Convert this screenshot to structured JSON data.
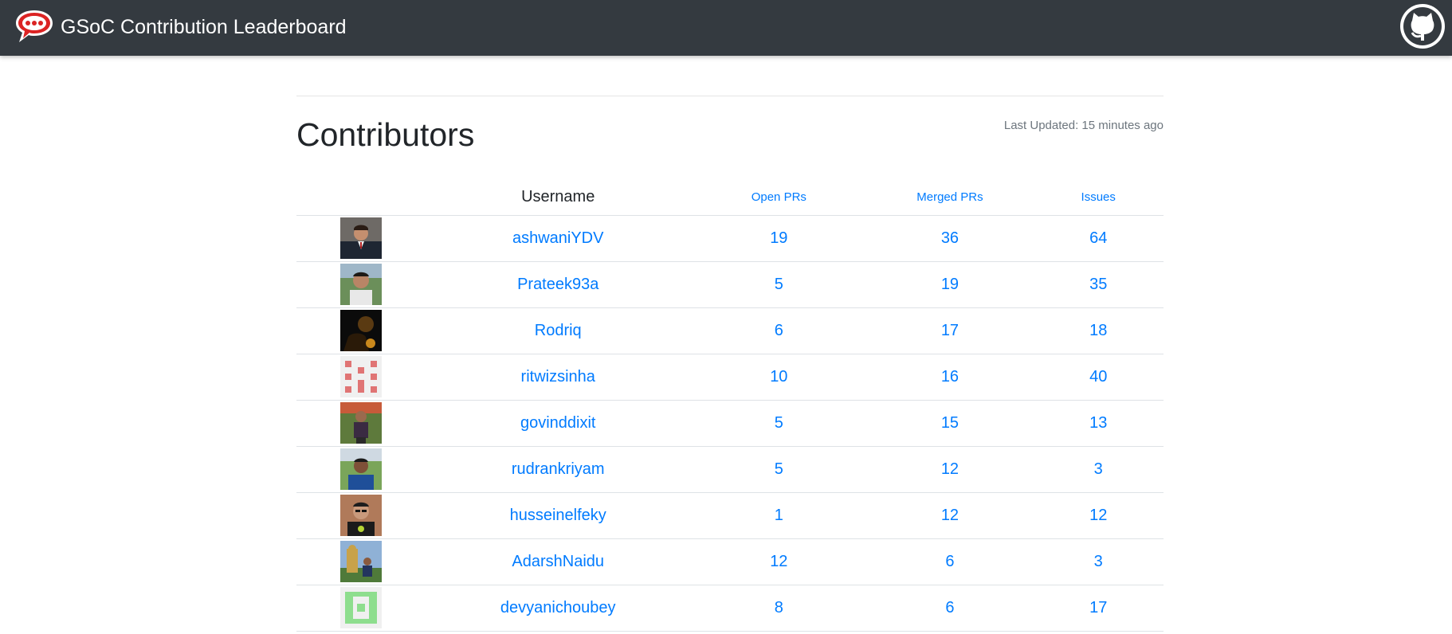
{
  "header": {
    "title": "GSoC Contribution Leaderboard",
    "logo_icon": "rocket-chat-logo-icon",
    "github_icon": "github-octocat-icon"
  },
  "page": {
    "heading": "Contributors",
    "last_updated": "Last Updated: 15 minutes ago"
  },
  "table": {
    "columns": [
      "",
      "Username",
      "Open PRs",
      "Merged PRs",
      "Issues"
    ],
    "rows": [
      {
        "avatar": "photo-man-suit",
        "username": "ashwaniYDV",
        "open_prs": "19",
        "merged_prs": "36",
        "issues": "64"
      },
      {
        "avatar": "photo-man-outdoor",
        "username": "Prateek93a",
        "open_prs": "5",
        "merged_prs": "19",
        "issues": "35"
      },
      {
        "avatar": "photo-silhouette",
        "username": "Rodriq",
        "open_prs": "6",
        "merged_prs": "17",
        "issues": "18"
      },
      {
        "avatar": "identicon-red",
        "username": "ritwizsinha",
        "open_prs": "10",
        "merged_prs": "16",
        "issues": "40"
      },
      {
        "avatar": "photo-man-garden",
        "username": "govinddixit",
        "open_prs": "5",
        "merged_prs": "15",
        "issues": "13"
      },
      {
        "avatar": "photo-man-blue-shirt",
        "username": "rudrankriyam",
        "open_prs": "5",
        "merged_prs": "12",
        "issues": "3"
      },
      {
        "avatar": "photo-man-glasses",
        "username": "husseinelfeky",
        "open_prs": "1",
        "merged_prs": "12",
        "issues": "12"
      },
      {
        "avatar": "photo-man-landmark",
        "username": "AdarshNaidu",
        "open_prs": "12",
        "merged_prs": "6",
        "issues": "3"
      },
      {
        "avatar": "identicon-green",
        "username": "devyanichoubey",
        "open_prs": "8",
        "merged_prs": "6",
        "issues": "17"
      }
    ]
  },
  "colors": {
    "navbar": "#343a40",
    "link": "#007bff",
    "muted": "#6c757d"
  }
}
